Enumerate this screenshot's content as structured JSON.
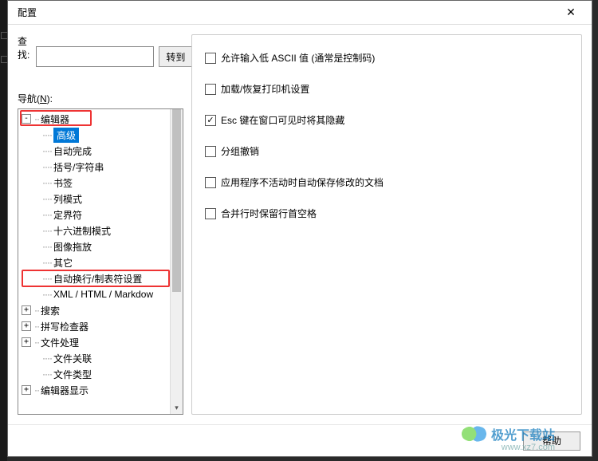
{
  "dialog": {
    "title": "配置",
    "close_icon": "✕"
  },
  "search": {
    "label": "查找:",
    "goto_label": "转到",
    "value": ""
  },
  "nav": {
    "label_prefix": "导航(",
    "label_accel": "N",
    "label_suffix": "):"
  },
  "tree": {
    "items": [
      {
        "label": "编辑器",
        "level": 1,
        "expander": "-",
        "selected": false
      },
      {
        "label": "高级",
        "level": 2,
        "expander": "",
        "selected": true
      },
      {
        "label": "自动完成",
        "level": 2,
        "expander": "",
        "selected": false
      },
      {
        "label": "括号/字符串",
        "level": 2,
        "expander": "",
        "selected": false
      },
      {
        "label": "书签",
        "level": 2,
        "expander": "",
        "selected": false
      },
      {
        "label": "列模式",
        "level": 2,
        "expander": "",
        "selected": false
      },
      {
        "label": "定界符",
        "level": 2,
        "expander": "",
        "selected": false
      },
      {
        "label": "十六进制模式",
        "level": 2,
        "expander": "",
        "selected": false
      },
      {
        "label": "图像拖放",
        "level": 2,
        "expander": "",
        "selected": false
      },
      {
        "label": "其它",
        "level": 2,
        "expander": "",
        "selected": false
      },
      {
        "label": "自动换行/制表符设置",
        "level": 2,
        "expander": "",
        "selected": false
      },
      {
        "label": "XML / HTML / Markdow",
        "level": 2,
        "expander": "",
        "selected": false
      },
      {
        "label": "搜索",
        "level": 1,
        "expander": "+",
        "selected": false
      },
      {
        "label": "拼写检查器",
        "level": 1,
        "expander": "+",
        "selected": false
      },
      {
        "label": "文件处理",
        "level": 1,
        "expander": "+",
        "selected": false
      },
      {
        "label": "文件关联",
        "level": 2,
        "expander": "",
        "selected": false
      },
      {
        "label": "文件类型",
        "level": 2,
        "expander": "",
        "selected": false
      },
      {
        "label": "编辑器显示",
        "level": 1,
        "expander": "+",
        "selected": false
      }
    ]
  },
  "options": [
    {
      "label": "允许输入低 ASCII 值 (通常是控制码)",
      "checked": false
    },
    {
      "label": "加载/恢复打印机设置",
      "checked": false
    },
    {
      "label": "Esc 键在窗口可见时将其隐藏",
      "checked": true
    },
    {
      "label": "分组撤销",
      "checked": false
    },
    {
      "label": "应用程序不活动时自动保存修改的文档",
      "checked": false
    },
    {
      "label": "合并行时保留行首空格",
      "checked": false
    }
  ],
  "footer": {
    "help_label": "帮助"
  },
  "watermark": {
    "text": "极光下载站",
    "url": "www.xz7.com"
  }
}
